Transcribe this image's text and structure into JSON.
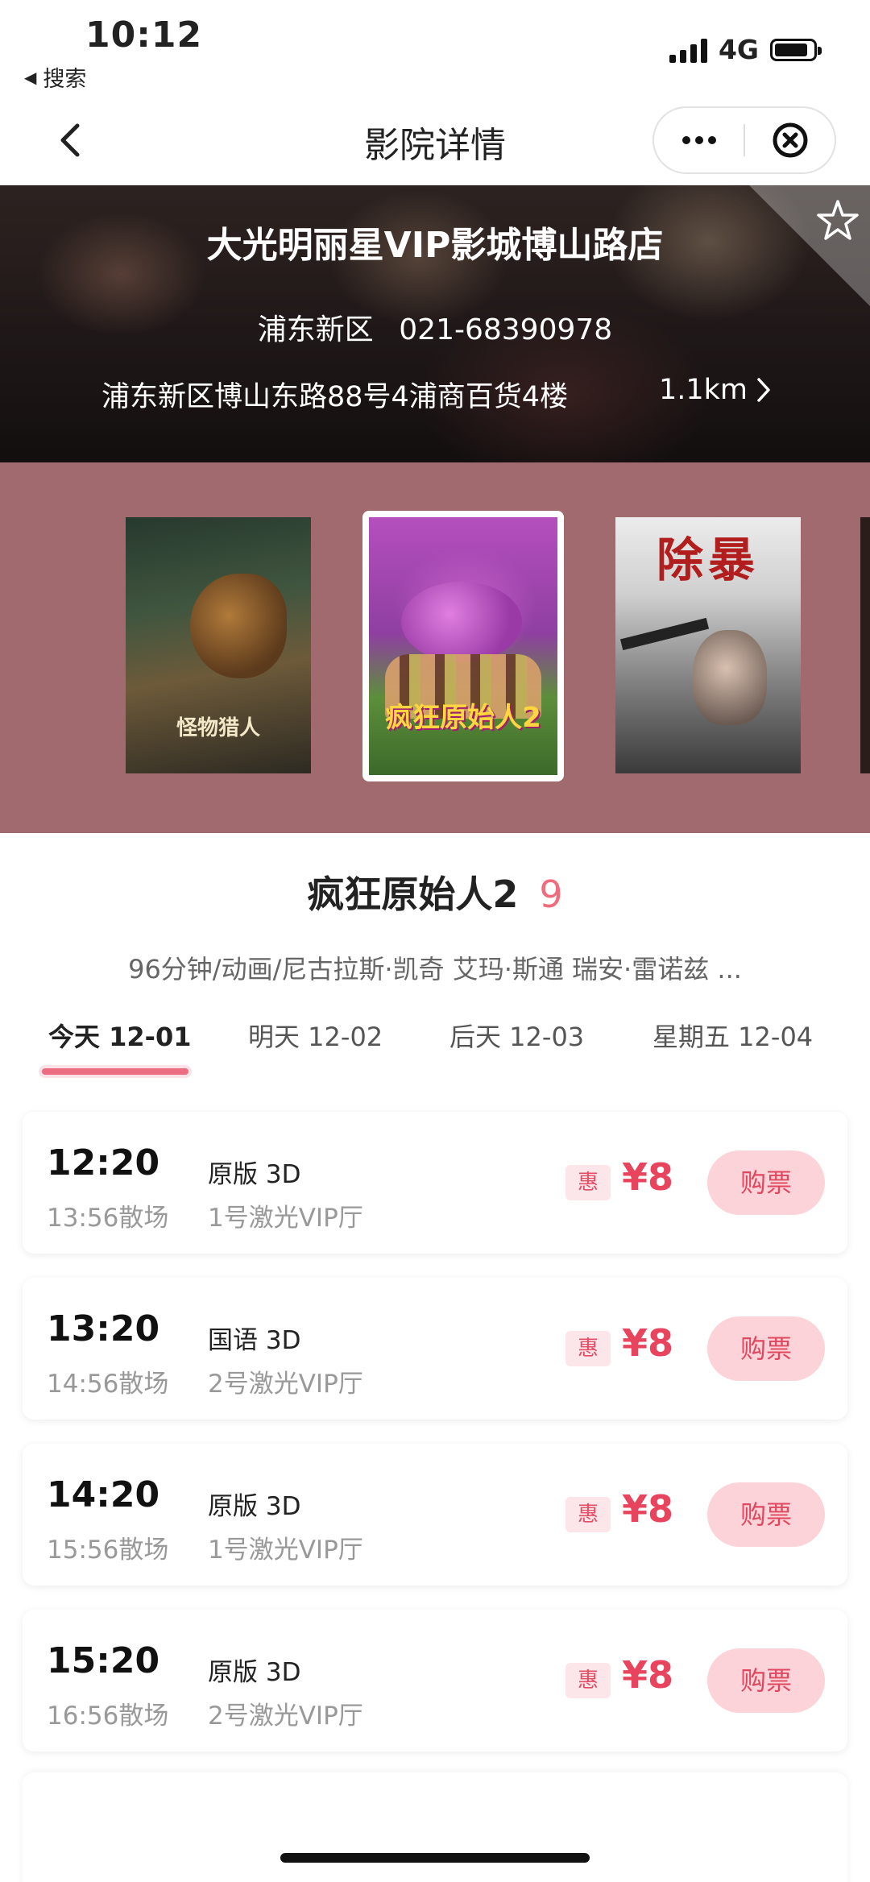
{
  "status_bar": {
    "time": "10:12",
    "back_app_label": "搜索",
    "network": "4G"
  },
  "nav": {
    "title": "影院详情"
  },
  "cinema": {
    "name": "大光明丽星VIP影城博山路店",
    "district": "浦东新区",
    "phone": "021-68390978",
    "address": "浦东新区博山东路88号4浦商百货4楼",
    "distance": "1.1km"
  },
  "posters": [
    {
      "title": "怪物猎人",
      "selected": false
    },
    {
      "title": "疯狂原始人2",
      "selected": true
    },
    {
      "title": "除暴",
      "selected": false
    }
  ],
  "movie": {
    "title": "疯狂原始人2",
    "score": "9",
    "description": "96分钟/动画/尼古拉斯·凯奇 艾玛·斯通 瑞安·雷诺兹 ..."
  },
  "date_tabs": [
    {
      "label": "今天 12-01",
      "active": true
    },
    {
      "label": "明天 12-02",
      "active": false
    },
    {
      "label": "后天 12-03",
      "active": false
    },
    {
      "label": "星期五 12-04",
      "active": false
    }
  ],
  "showtimes": [
    {
      "start": "12:20",
      "end": "13:56散场",
      "language": "原版 3D",
      "hall": "1号激光VIP厅",
      "promo": "惠",
      "price": "¥8",
      "buy_label": "购票"
    },
    {
      "start": "13:20",
      "end": "14:56散场",
      "language": "国语 3D",
      "hall": "2号激光VIP厅",
      "promo": "惠",
      "price": "¥8",
      "buy_label": "购票"
    },
    {
      "start": "14:20",
      "end": "15:56散场",
      "language": "原版 3D",
      "hall": "1号激光VIP厅",
      "promo": "惠",
      "price": "¥8",
      "buy_label": "购票"
    },
    {
      "start": "15:20",
      "end": "16:56散场",
      "language": "原版 3D",
      "hall": "2号激光VIP厅",
      "promo": "惠",
      "price": "¥8",
      "buy_label": "购票"
    }
  ],
  "colors": {
    "accent": "#ec6c81",
    "price": "#e8445e",
    "poster_strip_bg": "#a06a6e",
    "buy_button_bg": "#fbd3d9"
  },
  "icons": {
    "back": "chevron-left-icon",
    "more": "more-dots-icon",
    "close": "close-circle-icon",
    "favorite": "star-outline-icon",
    "distance_arrow": "chevron-right-icon"
  }
}
